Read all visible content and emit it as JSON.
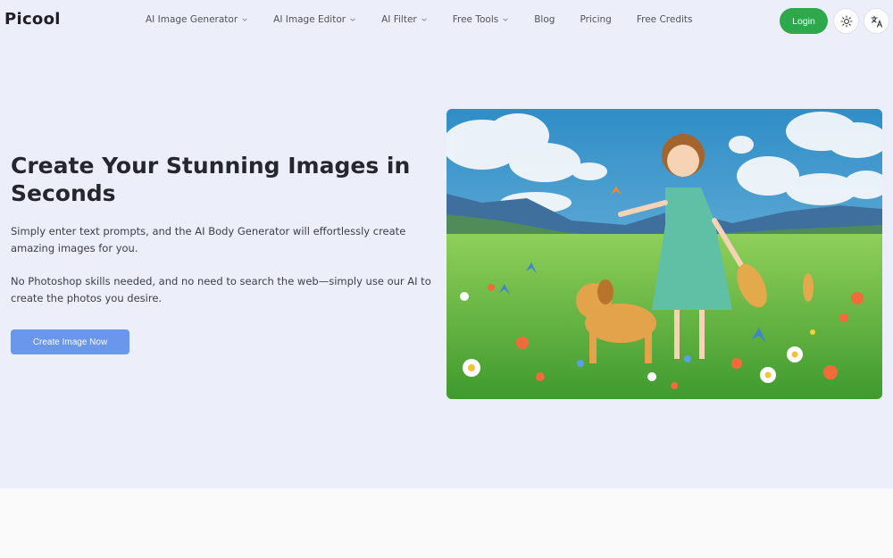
{
  "header": {
    "logo": "Picool",
    "nav": [
      {
        "label": "AI Image Generator",
        "has_dropdown": true
      },
      {
        "label": "AI Image Editor",
        "has_dropdown": true
      },
      {
        "label": "AI Filter",
        "has_dropdown": true
      },
      {
        "label": "Free Tools",
        "has_dropdown": true
      },
      {
        "label": "Blog",
        "has_dropdown": false
      },
      {
        "label": "Pricing",
        "has_dropdown": false
      },
      {
        "label": "Free Credits",
        "has_dropdown": false
      }
    ],
    "login_label": "Login",
    "theme_icon": "sun-icon",
    "language_icon": "translate-icon"
  },
  "hero": {
    "title": "Create Your Stunning Images in Seconds",
    "paragraph_1": "Simply enter text prompts, and the AI Body Generator will effortlessly create amazing images for you.",
    "paragraph_2": "No Photoshop skills needed, and no need to search the web—simply use our AI to create the photos you desire.",
    "cta_label": "Create Image Now",
    "image": "anime-girl-with-dog-in-flower-meadow-illustration"
  },
  "colors": {
    "accent_green": "#2da84a",
    "cta_blue": "#6a97ec",
    "hero_bg": "#eceef9"
  }
}
